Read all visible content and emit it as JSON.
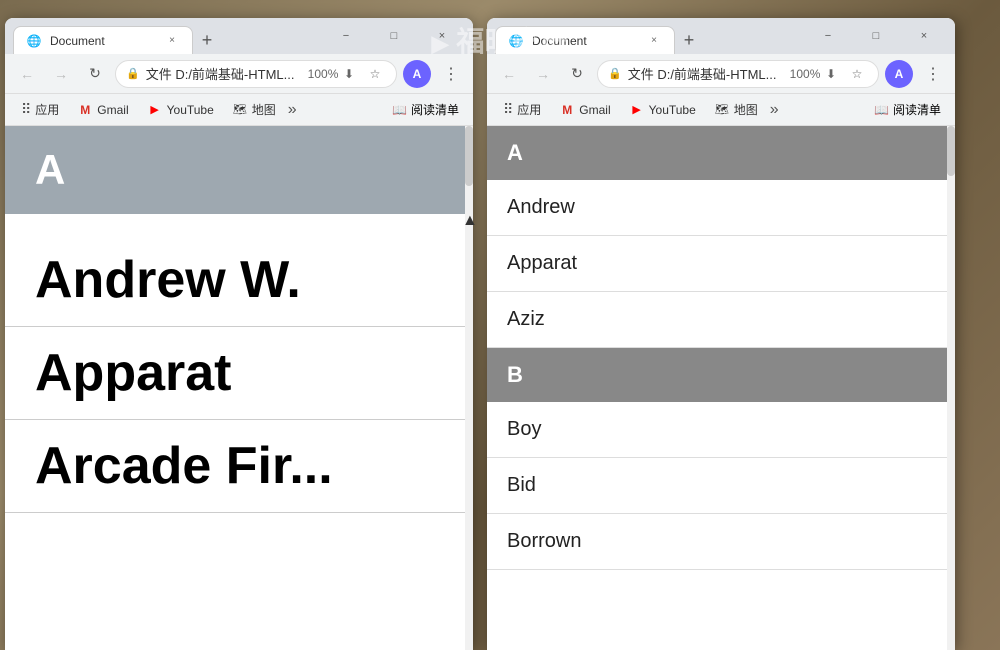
{
  "background": {
    "color": "#8B7355"
  },
  "watermark": {
    "text": "福昕家屏"
  },
  "left_window": {
    "title": "Document",
    "tab": {
      "label": "Document",
      "favicon": "📄",
      "close": "×"
    },
    "new_tab": "+",
    "controls": {
      "minimize": "−",
      "maximize": "□",
      "close": "×"
    },
    "toolbar": {
      "back_disabled": true,
      "forward_disabled": true,
      "reload": "↺",
      "url": "文件  D:/前端基础-HTML...",
      "url_icon": "🔒",
      "zoom": "100",
      "bookmark": "☆",
      "profile_letter": "A",
      "menu": "⋮"
    },
    "bookmarks": {
      "apps_label": "应用",
      "items": [
        {
          "name": "Gmail",
          "label": "Gmail"
        },
        {
          "name": "YouTube",
          "label": "YouTube"
        },
        {
          "name": "Maps",
          "label": "地图"
        }
      ],
      "more": "»",
      "reading": "阅读清单"
    },
    "content": {
      "sections": [
        {
          "header": "A",
          "entries": [
            "Andrew W.",
            "Apparat",
            "Arcade Fir..."
          ]
        }
      ]
    }
  },
  "right_window": {
    "title": "Document",
    "tab": {
      "label": "Document",
      "favicon": "📄",
      "close": "×"
    },
    "new_tab": "+",
    "controls": {
      "minimize": "−",
      "maximize": "□",
      "close": "×"
    },
    "toolbar": {
      "back_disabled": true,
      "forward_disabled": true,
      "reload": "↺",
      "url": "文件  D:/前端基础-HTML...",
      "url_icon": "🔒",
      "zoom": "100",
      "bookmark": "☆",
      "profile_letter": "A",
      "menu": "⋮"
    },
    "bookmarks": {
      "apps_label": "应用",
      "items": [
        {
          "name": "Gmail",
          "label": "Gmail"
        },
        {
          "name": "YouTube",
          "label": "YouTube"
        },
        {
          "name": "Maps",
          "label": "地图"
        }
      ],
      "more": "»",
      "reading": "阅读清单"
    },
    "content": {
      "sections": [
        {
          "header": "A",
          "entries": [
            "Andrew",
            "Apparat",
            "Aziz"
          ]
        },
        {
          "header": "B",
          "entries": [
            "Boy",
            "Bid",
            "Borrown"
          ]
        }
      ]
    }
  }
}
